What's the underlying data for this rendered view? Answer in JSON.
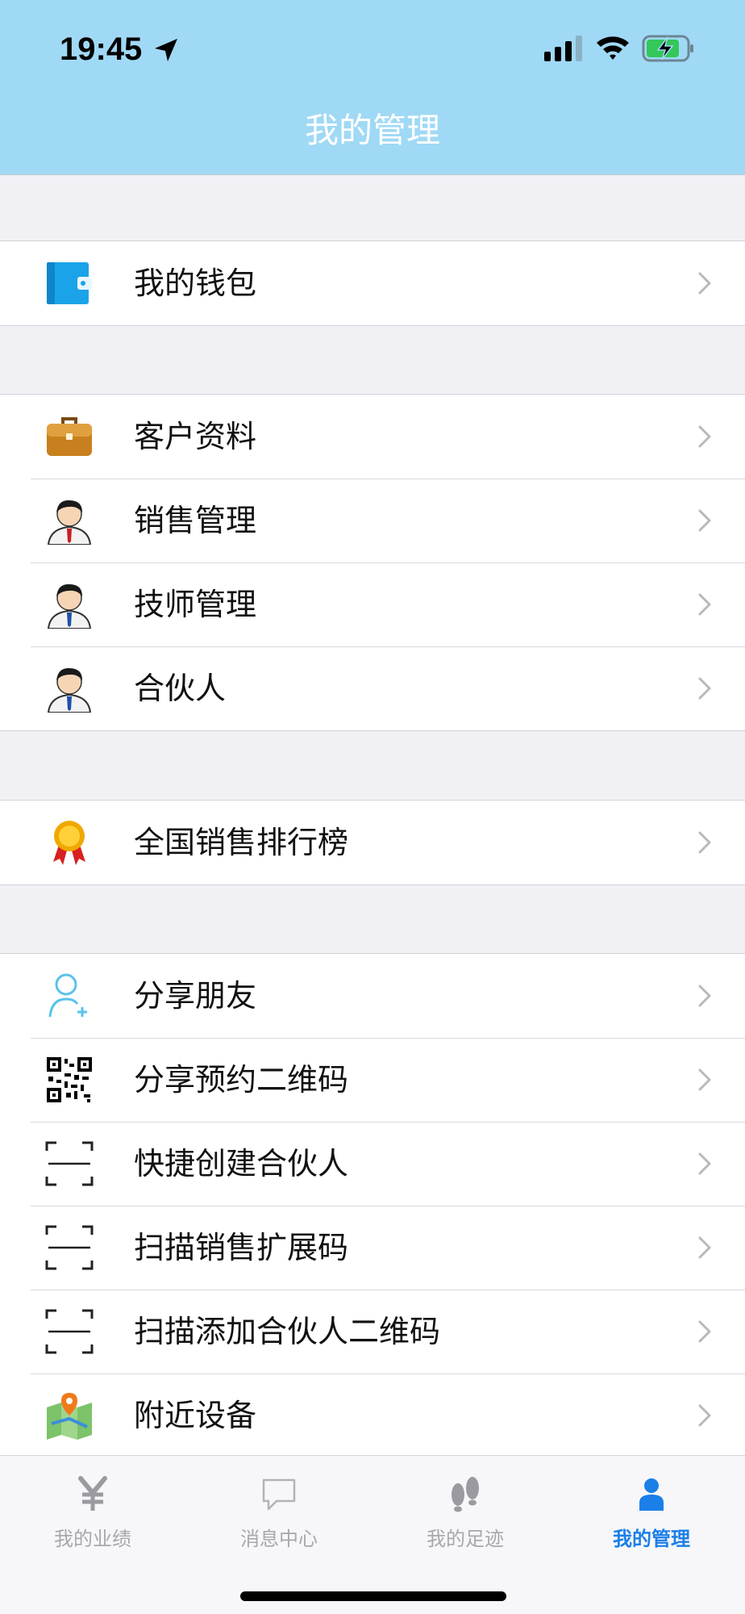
{
  "status_bar": {
    "time": "19:45"
  },
  "header": {
    "title": "我的管理"
  },
  "groups": [
    {
      "items": [
        {
          "icon": "wallet-icon",
          "label": "我的钱包"
        }
      ]
    },
    {
      "items": [
        {
          "icon": "briefcase-icon",
          "label": "客户资料"
        },
        {
          "icon": "salesman-icon",
          "label": "销售管理"
        },
        {
          "icon": "technician-icon",
          "label": "技师管理"
        },
        {
          "icon": "partner-icon",
          "label": "合伙人"
        }
      ]
    },
    {
      "items": [
        {
          "icon": "medal-icon",
          "label": "全国销售排行榜"
        }
      ]
    },
    {
      "items": [
        {
          "icon": "add-friend-icon",
          "label": "分享朋友"
        },
        {
          "icon": "qr-code-icon",
          "label": "分享预约二维码"
        },
        {
          "icon": "scan-icon",
          "label": "快捷创建合伙人"
        },
        {
          "icon": "scan-icon",
          "label": "扫描销售扩展码"
        },
        {
          "icon": "scan-icon",
          "label": "扫描添加合伙人二维码"
        },
        {
          "icon": "map-icon",
          "label": "附近设备"
        }
      ]
    }
  ],
  "tabbar": {
    "tabs": [
      {
        "icon": "yen-icon",
        "label": "我的业绩",
        "active": false
      },
      {
        "icon": "chat-bubble-icon",
        "label": "消息中心",
        "active": false
      },
      {
        "icon": "footprints-icon",
        "label": "我的足迹",
        "active": false
      },
      {
        "icon": "person-icon",
        "label": "我的管理",
        "active": true
      }
    ]
  },
  "colors": {
    "header_bg": "#a0d9f5",
    "accent": "#1b7fe8",
    "inactive": "#a8a8ac"
  }
}
